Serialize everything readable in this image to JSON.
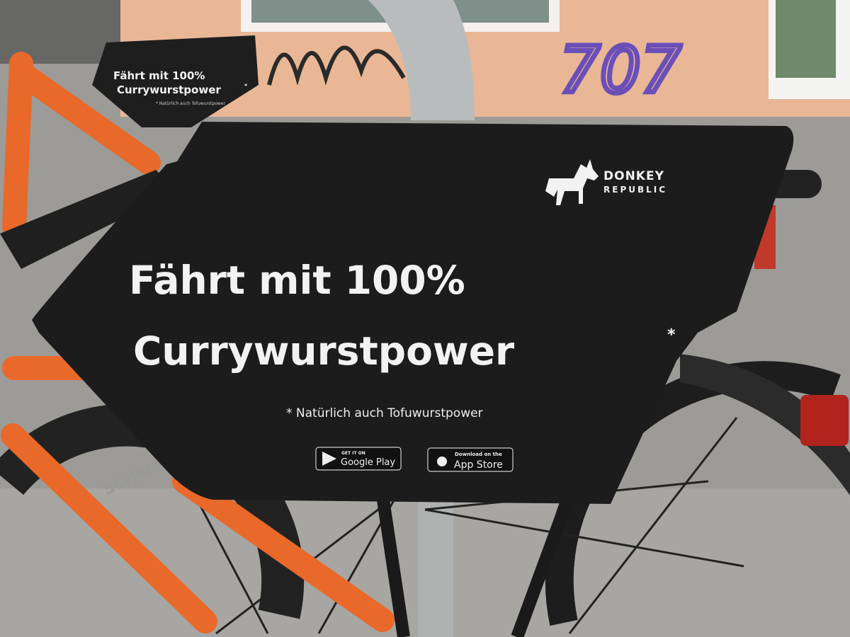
{
  "colors": {
    "sign": "#1c1c1c",
    "frame_orange": "#e8692a",
    "wall": "#e9b795",
    "pavement": "#9a9a98",
    "text": "#f2f2f2",
    "graffiti": "#6a4fb8"
  },
  "main_sign": {
    "brand_line1": "DONKEY",
    "brand_line2": "REPUBLIC",
    "headline_line1": "Fährt mit 100%",
    "headline_line2": "Currywurstpower",
    "asterisk": "*",
    "footnote": "* Natürlich auch Tofuwurstpower",
    "google_play": {
      "small": "GET IT ON",
      "big": "Google Play",
      "icon": "play-store-icon"
    },
    "app_store": {
      "small": "Download on the",
      "big": "App Store",
      "icon": "apple-icon"
    },
    "logo_icon": "donkey-icon"
  },
  "background_sign": {
    "headline_line1": "Fährt mit 100%",
    "headline_line2": "Currywurstpower",
    "asterisk": "*",
    "footnote": "* Natürlich auch Tofuwurstpower"
  },
  "graffiti": "707",
  "tire_text": "SCHWALBE"
}
